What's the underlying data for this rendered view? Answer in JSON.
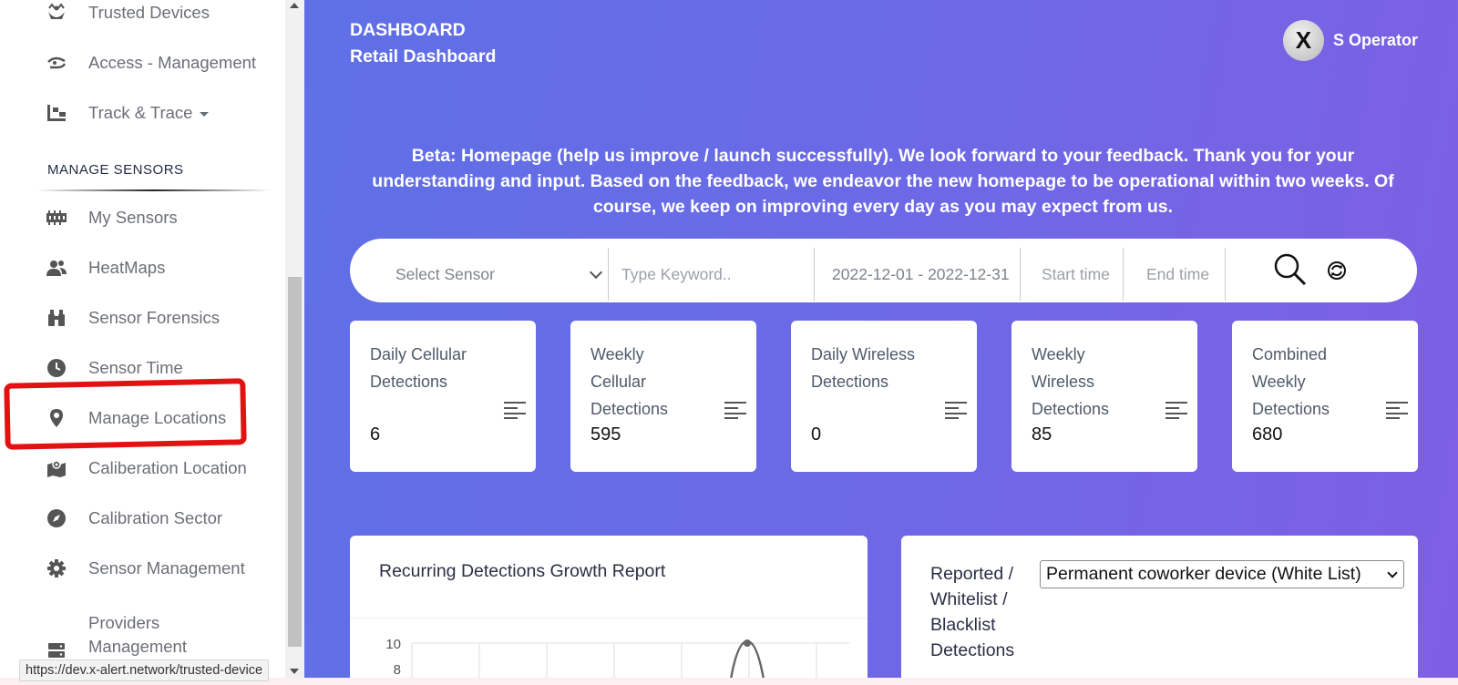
{
  "sidebar": {
    "items_top": [
      {
        "label": "Trusted Devices",
        "icon": "trusted-devices-icon"
      },
      {
        "label": "Access - Management",
        "icon": "access-management-icon"
      },
      {
        "label": "Track & Trace",
        "icon": "track-trace-icon"
      }
    ],
    "section_header": "MANAGE SENSORS",
    "items": [
      {
        "label": "My Sensors",
        "icon": "sensor-icon"
      },
      {
        "label": "HeatMaps",
        "icon": "users-icon"
      },
      {
        "label": "Sensor Forensics",
        "icon": "binoculars-icon"
      },
      {
        "label": "Sensor Time",
        "icon": "clock-icon"
      },
      {
        "label": "Manage Locations",
        "icon": "map-pin-icon"
      },
      {
        "label": "Caliberation Location",
        "icon": "map-location-icon"
      },
      {
        "label": "Calibration Sector",
        "icon": "compass-icon"
      },
      {
        "label": "Sensor Management",
        "icon": "gear-icon"
      },
      {
        "label": "Providers Management",
        "icon": "server-icon"
      }
    ]
  },
  "header": {
    "breadcrumb_title": "DASHBOARD",
    "breadcrumb_sub": "Retail Dashboard",
    "user_initial": "X",
    "user_name": "S Operator"
  },
  "beta_message": "Beta: Homepage (help us improve / launch successfully). We look forward to your feedback. Thank you for your understanding and input. Based on the feedback, we endeavor the new homepage to be operational within two weeks. Of course, we keep on improving every day as you may expect from us.",
  "filters": {
    "sensor_placeholder": "Select Sensor",
    "keyword_placeholder": "Type Keyword..",
    "date_range": "2022-12-01 - 2022-12-31",
    "start_time_placeholder": "Start time",
    "end_time_placeholder": "End time"
  },
  "cards": [
    {
      "title": "Daily Cellular Detections",
      "value": "6"
    },
    {
      "title": "Weekly Cellular Detections",
      "value": "595"
    },
    {
      "title": "Daily Wireless Detections",
      "value": "0"
    },
    {
      "title": "Weekly Wireless Detections",
      "value": "85"
    },
    {
      "title": "Combined Weekly Detections",
      "value": "680"
    }
  ],
  "growth_report": {
    "title": "Recurring Detections Growth Report",
    "y_ticks": [
      "10",
      "8"
    ]
  },
  "reported_panel": {
    "label": "Reported / Whitelist / Blacklist Detections",
    "selected_option": "Permanent coworker device (White List)"
  },
  "status_url": "https://dev.x-alert.network/trusted-device",
  "colors": {
    "gradient_start": "#5f70e6",
    "gradient_end": "#7e5fe4",
    "highlight": "#e31212"
  }
}
